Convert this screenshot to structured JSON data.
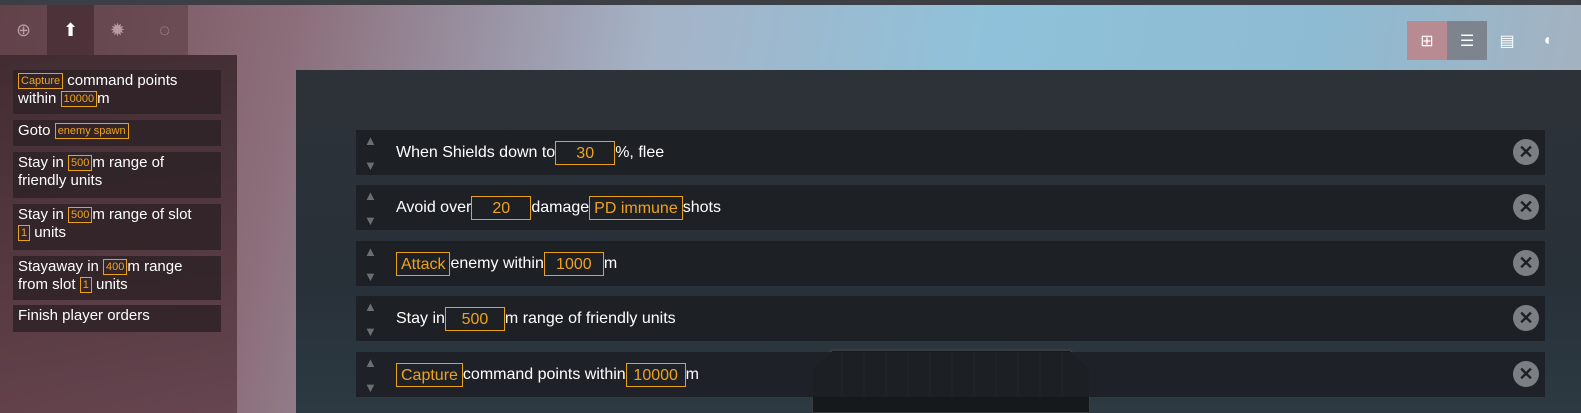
{
  "tabs": [
    {
      "icon": "plus-circle-icon",
      "glyph": "⊕"
    },
    {
      "icon": "arrow-up-icon",
      "glyph": "⬆"
    },
    {
      "icon": "starburst-icon",
      "glyph": "✹"
    },
    {
      "icon": "ring-icon",
      "glyph": "◌"
    }
  ],
  "left_panel": {
    "item1": {
      "tag": "Capture",
      "t1": " command points",
      "t2": "within ",
      "tag2": "10000",
      "t3": "m"
    },
    "item2": {
      "t1": "Goto ",
      "tag": "enemy spawn"
    },
    "item3": {
      "t1": "Stay in ",
      "tag": "500",
      "t2": "m range of",
      "t3": "friendly units"
    },
    "item4": {
      "t1": "Stay in ",
      "tag": "500",
      "t2": "m range of slot",
      "tag2": "1",
      "t3": " units"
    },
    "item5": {
      "t1": "Stayaway in ",
      "tag": "400",
      "t2": "m range",
      "t3": "from slot ",
      "tag2": "1",
      "t4": " units"
    },
    "item6": {
      "t1": "Finish player orders"
    }
  },
  "toolbar": [
    {
      "icon": "grid-target-icon",
      "glyph": "⊞"
    },
    {
      "icon": "list-icon",
      "glyph": "☰"
    },
    {
      "icon": "card-icon",
      "glyph": "▤"
    },
    {
      "icon": "sound-icon",
      "glyph": "◖"
    }
  ],
  "rows": {
    "r1": {
      "t1": "When Shields down to ",
      "v1": "30",
      "t2": "%, flee"
    },
    "r2": {
      "t1": "Avoid over ",
      "v1": "20",
      "t2": "damage ",
      "v2": "PD immune",
      "t3": " shots"
    },
    "r3": {
      "v1": "Attack",
      "t1": " enemy within ",
      "v2": "1000",
      "t2": "m"
    },
    "r4": {
      "t1": "Stay in ",
      "v1": "500",
      "t2": "m range of friendly units"
    },
    "r5": {
      "v1": "Capture",
      "t1": " command points within ",
      "v2": "10000",
      "t2": "m"
    }
  },
  "close_glyph": "✕",
  "arrow_up": "▲",
  "arrow_down": "▼",
  "colors": {
    "accent": "#f0a21f",
    "row_bg": "#1d2126",
    "panel_bg": "#2d3238"
  }
}
